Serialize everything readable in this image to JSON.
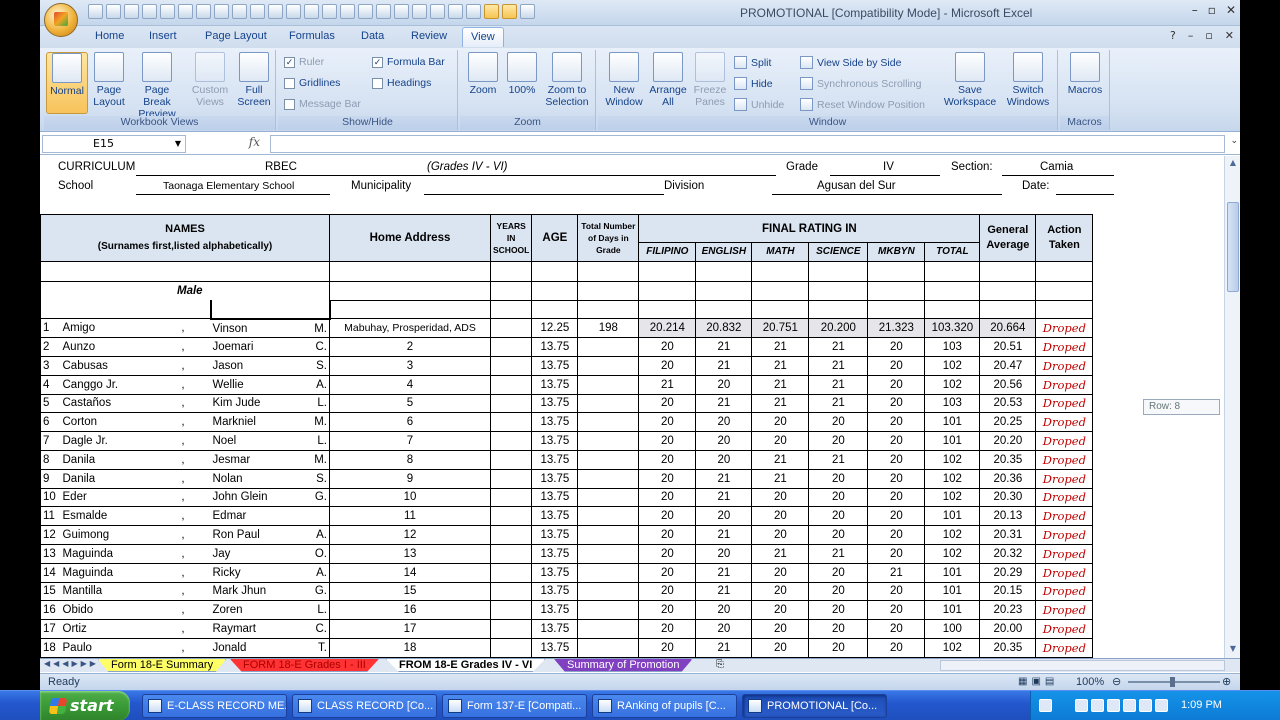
{
  "window": {
    "title": "PROMOTIONAL  [Compatibility Mode] - Microsoft Excel"
  },
  "ribbon": {
    "tabs": [
      "Home",
      "Insert",
      "Page Layout",
      "Formulas",
      "Data",
      "Review",
      "View"
    ],
    "active_tab": "View",
    "groups": {
      "workbook_views": {
        "label": "Workbook Views",
        "normal": "Normal",
        "page_layout": "Page Layout",
        "page_break": "Page Break Preview",
        "custom_views": "Custom Views",
        "full_screen": "Full Screen"
      },
      "show_hide": {
        "label": "Show/Hide",
        "ruler": "Ruler",
        "gridlines": "Gridlines",
        "message_bar": "Message Bar",
        "formula_bar": "Formula Bar",
        "headings": "Headings"
      },
      "zoom": {
        "label": "Zoom",
        "zoom": "Zoom",
        "hundred": "100%",
        "zoom_to_selection": "Zoom to Selection"
      },
      "window": {
        "label": "Window",
        "new_window": "New Window",
        "arrange_all": "Arrange All",
        "freeze_panes": "Freeze Panes",
        "split": "Split",
        "hide": "Hide",
        "unhide": "Unhide",
        "view_side_by_side": "View Side by Side",
        "sync_scrolling": "Synchronous Scrolling",
        "reset_position": "Reset Window Position",
        "save_workspace": "Save Workspace",
        "switch_windows": "Switch Windows"
      },
      "macros": {
        "label": "Macros",
        "macros": "Macros"
      }
    }
  },
  "formula_bar": {
    "name_box": "E15",
    "fx": "fx",
    "value": ""
  },
  "header": {
    "curriculum_label": "CURRICULUM",
    "curriculum": "RBEC",
    "grades": "(Grades IV - VI)",
    "grade_label": "Grade",
    "grade": "IV",
    "section_label": "Section:",
    "section": "Camia",
    "school_label": "School",
    "school": "Taonaga Elementary School",
    "municipality_label": "Municipality",
    "division_label": "Division",
    "division": "Agusan del Sur",
    "date_label": "Date:"
  },
  "table": {
    "col_names": "NAMES",
    "col_names_sub": "(Surnames first,listed alphabetically)",
    "col_address": "Home Address",
    "col_years": "YEARS IN SCHOOL",
    "col_age": "AGE",
    "col_days": "Total Number of Days in Grade",
    "col_final": "FINAL RATING IN",
    "subjects": [
      "FILIPINO",
      "ENGLISH",
      "MATH",
      "SCIENCE",
      "MKBYN",
      "TOTAL"
    ],
    "col_general": "General Average",
    "col_action": "Action Taken",
    "section_male": "Male",
    "rows": [
      {
        "n": "1",
        "sur": "Amigo",
        "first": "Vinson",
        "mi": "M.",
        "addr": "Mabuhay, Prosperidad, ADS",
        "age": "12.25",
        "days": "198",
        "fil": "20.214",
        "eng": "20.832",
        "math": "20.751",
        "sci": "20.200",
        "mk": "21.323",
        "tot": "103.320",
        "ga": "20.664",
        "act": "Droped"
      },
      {
        "n": "2",
        "sur": "Aunzo",
        "first": "Joemari",
        "mi": "C.",
        "addr": "2",
        "age": "13.75",
        "days": "",
        "fil": "20",
        "eng": "21",
        "math": "21",
        "sci": "21",
        "mk": "20",
        "tot": "103",
        "ga": "20.51",
        "act": "Droped"
      },
      {
        "n": "3",
        "sur": "Cabusas",
        "first": "Jason",
        "mi": "S.",
        "addr": "3",
        "age": "13.75",
        "days": "",
        "fil": "20",
        "eng": "21",
        "math": "21",
        "sci": "21",
        "mk": "20",
        "tot": "102",
        "ga": "20.47",
        "act": "Droped"
      },
      {
        "n": "4",
        "sur": "Canggo Jr.",
        "first": "Wellie",
        "mi": "A.",
        "addr": "4",
        "age": "13.75",
        "days": "",
        "fil": "21",
        "eng": "20",
        "math": "21",
        "sci": "21",
        "mk": "20",
        "tot": "102",
        "ga": "20.56",
        "act": "Droped"
      },
      {
        "n": "5",
        "sur": "Castaños",
        "first": "Kim Jude",
        "mi": "L.",
        "addr": "5",
        "age": "13.75",
        "days": "",
        "fil": "20",
        "eng": "21",
        "math": "21",
        "sci": "21",
        "mk": "20",
        "tot": "103",
        "ga": "20.53",
        "act": "Droped"
      },
      {
        "n": "6",
        "sur": "Corton",
        "first": "Markniel",
        "mi": "M.",
        "addr": "6",
        "age": "13.75",
        "days": "",
        "fil": "20",
        "eng": "20",
        "math": "20",
        "sci": "20",
        "mk": "20",
        "tot": "101",
        "ga": "20.25",
        "act": "Droped"
      },
      {
        "n": "7",
        "sur": "Dagle Jr.",
        "first": "Noel",
        "mi": "L.",
        "addr": "7",
        "age": "13.75",
        "days": "",
        "fil": "20",
        "eng": "20",
        "math": "20",
        "sci": "20",
        "mk": "20",
        "tot": "101",
        "ga": "20.20",
        "act": "Droped"
      },
      {
        "n": "8",
        "sur": "Danila",
        "first": "Jesmar",
        "mi": "M.",
        "addr": "8",
        "age": "13.75",
        "days": "",
        "fil": "20",
        "eng": "20",
        "math": "21",
        "sci": "21",
        "mk": "20",
        "tot": "102",
        "ga": "20.35",
        "act": "Droped"
      },
      {
        "n": "9",
        "sur": "Danila",
        "first": "Nolan",
        "mi": "S.",
        "addr": "9",
        "age": "13.75",
        "days": "",
        "fil": "20",
        "eng": "21",
        "math": "21",
        "sci": "20",
        "mk": "20",
        "tot": "102",
        "ga": "20.36",
        "act": "Droped"
      },
      {
        "n": "10",
        "sur": "Eder",
        "first": "John Glein",
        "mi": "G.",
        "addr": "10",
        "age": "13.75",
        "days": "",
        "fil": "20",
        "eng": "21",
        "math": "20",
        "sci": "20",
        "mk": "20",
        "tot": "102",
        "ga": "20.30",
        "act": "Droped"
      },
      {
        "n": "11",
        "sur": "Esmalde",
        "first": "Edmar",
        "mi": "",
        "addr": "11",
        "age": "13.75",
        "days": "",
        "fil": "20",
        "eng": "20",
        "math": "20",
        "sci": "20",
        "mk": "20",
        "tot": "101",
        "ga": "20.13",
        "act": "Droped"
      },
      {
        "n": "12",
        "sur": "Guimong",
        "first": "Ron Paul",
        "mi": "A.",
        "addr": "12",
        "age": "13.75",
        "days": "",
        "fil": "20",
        "eng": "21",
        "math": "20",
        "sci": "20",
        "mk": "20",
        "tot": "102",
        "ga": "20.31",
        "act": "Droped"
      },
      {
        "n": "13",
        "sur": "Maguinda",
        "first": "Jay",
        "mi": "O.",
        "addr": "13",
        "age": "13.75",
        "days": "",
        "fil": "20",
        "eng": "20",
        "math": "21",
        "sci": "21",
        "mk": "20",
        "tot": "102",
        "ga": "20.32",
        "act": "Droped"
      },
      {
        "n": "14",
        "sur": "Maguinda",
        "first": "Ricky",
        "mi": "A.",
        "addr": "14",
        "age": "13.75",
        "days": "",
        "fil": "20",
        "eng": "21",
        "math": "20",
        "sci": "20",
        "mk": "21",
        "tot": "101",
        "ga": "20.29",
        "act": "Droped"
      },
      {
        "n": "15",
        "sur": "Mantilla",
        "first": "Mark Jhun",
        "mi": "G.",
        "addr": "15",
        "age": "13.75",
        "days": "",
        "fil": "20",
        "eng": "21",
        "math": "20",
        "sci": "20",
        "mk": "20",
        "tot": "101",
        "ga": "20.15",
        "act": "Droped"
      },
      {
        "n": "16",
        "sur": "Obido",
        "first": "Zoren",
        "mi": "L.",
        "addr": "16",
        "age": "13.75",
        "days": "",
        "fil": "20",
        "eng": "20",
        "math": "20",
        "sci": "20",
        "mk": "20",
        "tot": "101",
        "ga": "20.23",
        "act": "Droped"
      },
      {
        "n": "17",
        "sur": "Ortiz",
        "first": "Raymart",
        "mi": "C.",
        "addr": "17",
        "age": "13.75",
        "days": "",
        "fil": "20",
        "eng": "20",
        "math": "20",
        "sci": "20",
        "mk": "20",
        "tot": "100",
        "ga": "20.00",
        "act": "Droped"
      },
      {
        "n": "18",
        "sur": "Paulo",
        "first": "Jonald",
        "mi": "T.",
        "addr": "18",
        "age": "13.75",
        "days": "",
        "fil": "20",
        "eng": "21",
        "math": "20",
        "sci": "20",
        "mk": "20",
        "tot": "102",
        "ga": "20.35",
        "act": "Droped"
      }
    ]
  },
  "row_tooltip": "Row: 8",
  "sheet_tabs": [
    {
      "label": "Form 18-E Summary",
      "color": "#ffff66",
      "text": "#000"
    },
    {
      "label": "FORM 18-E Grades I - III",
      "color": "#ff3333",
      "text": "#a00"
    },
    {
      "label": "FROM 18-E Grades IV - VI",
      "color": "#ffffff",
      "text": "#000"
    },
    {
      "label": "Summary of Promotion",
      "color": "#8040c0",
      "text": "#fff"
    }
  ],
  "status": {
    "ready": "Ready",
    "zoom": "100%"
  },
  "taskbar": {
    "start": "start",
    "buttons": [
      "E-CLASS RECORD ME...",
      "CLASS RECORD  [Co...",
      "Form 137-E  [Compati...",
      "RAnking of pupils  [C...",
      "PROMOTIONAL  [Co..."
    ],
    "active_index": 4,
    "time": "1:09 PM"
  },
  "colors": {
    "header_fill": "#dbe5f1",
    "dropped_text": "#c00000",
    "ribbon": "#d5e2f2",
    "taskbar": "#2458cf"
  }
}
